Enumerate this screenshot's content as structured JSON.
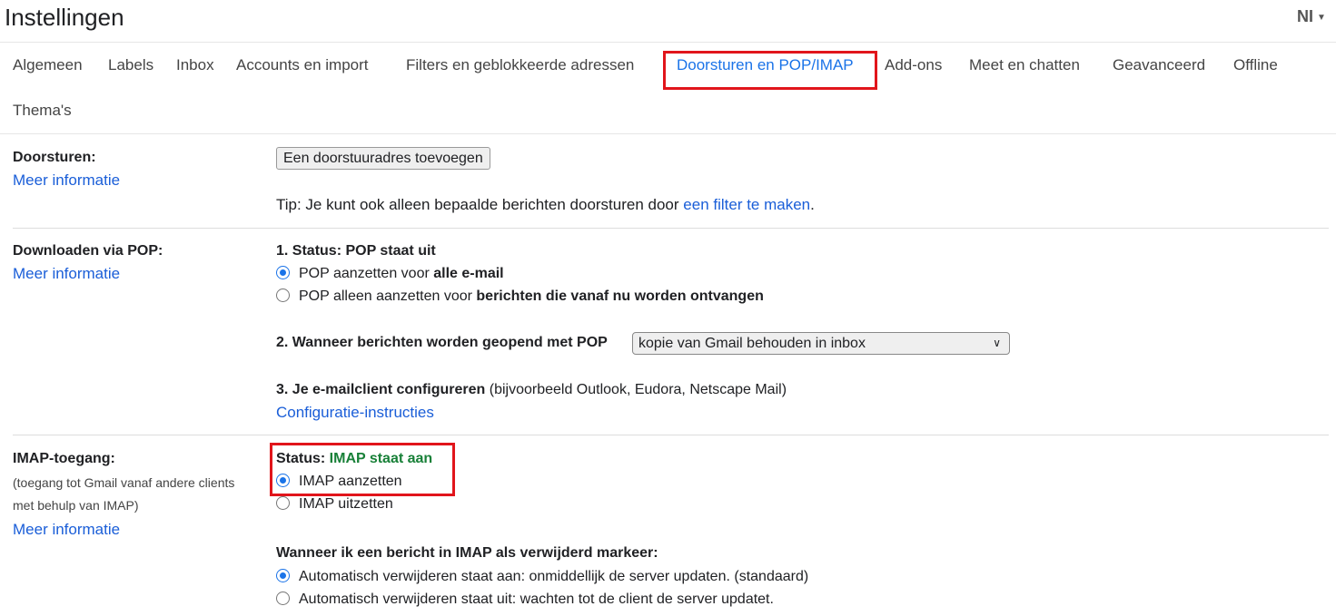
{
  "header": {
    "title": "Instellingen",
    "language": "NI"
  },
  "tabs": [
    "Algemeen",
    "Labels",
    "Inbox",
    "Accounts en import",
    "Filters en geblokkeerde adressen",
    "Doorsturen en POP/IMAP",
    "Add-ons",
    "Meet en chatten",
    "Geavanceerd",
    "Offline",
    "Thema's"
  ],
  "active_tab": "Doorsturen en POP/IMAP",
  "forwarding": {
    "label": "Doorsturen:",
    "more": "Meer informatie",
    "button": "Een doorstuuradres toevoegen",
    "tip_prefix": "Tip: Je kunt ook alleen bepaalde berichten doorsturen door ",
    "tip_link": "een filter te maken",
    "tip_suffix": "."
  },
  "pop": {
    "label": "Downloaden via POP:",
    "more": "Meer informatie",
    "status": "1. Status: POP staat uit",
    "opt1_prefix": "POP aanzetten voor ",
    "opt1_bold": "alle e-mail",
    "opt1_selected": true,
    "opt2_prefix": "POP alleen aanzetten voor ",
    "opt2_bold": "berichten die vanaf nu worden ontvangen",
    "opt2_selected": false,
    "when_label": "2. Wanneer berichten worden geopend met POP",
    "when_value": "kopie van Gmail behouden in inbox",
    "config_bold": "3. Je e-mailclient configureren",
    "config_rest": " (bijvoorbeeld Outlook, Eudora, Netscape Mail)",
    "config_link": "Configuratie-instructies"
  },
  "imap": {
    "label": "IMAP-toegang:",
    "desc1": "(toegang tot Gmail vanaf andere clients",
    "desc2": "met behulp van IMAP)",
    "more": "Meer informatie",
    "status_label": "Status: ",
    "status_value": "IMAP staat aan",
    "on": "IMAP aanzetten",
    "off": "IMAP uitzetten",
    "enabled": true,
    "delete_heading": "Wanneer ik een bericht in IMAP als verwijderd markeer:",
    "auto_on": "Automatisch verwijderen staat aan: onmiddellijk de server updaten. (standaard)",
    "auto_off": "Automatisch verwijderen staat uit: wachten tot de client de server updatet.",
    "auto_on_selected": true
  },
  "colors": {
    "highlight": "#e1151b",
    "link": "#1a5ed8",
    "status_on": "#188038"
  }
}
